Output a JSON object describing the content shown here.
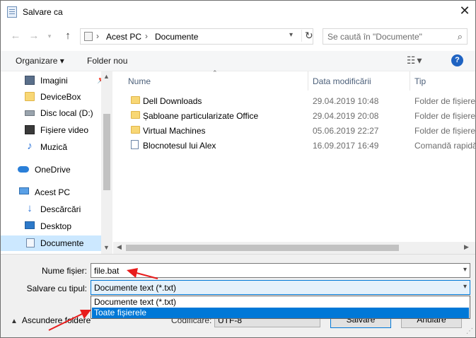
{
  "window": {
    "title": "Salvare ca",
    "close_label": "✕"
  },
  "address": {
    "crumbs": [
      "Acest PC",
      "Documente"
    ],
    "separator": "›"
  },
  "search": {
    "placeholder": "Se caută în \"Documente\""
  },
  "toolbar": {
    "organize_label": "Organizare",
    "organize_caret": "▾",
    "new_folder_label": "Folder nou",
    "help_label": "?"
  },
  "sidebar": {
    "items": [
      {
        "label": "Imagini",
        "icon": "images-icon"
      },
      {
        "label": "DeviceBox",
        "icon": "folder-icon"
      },
      {
        "label": "Disc local (D:)",
        "icon": "drive-icon"
      },
      {
        "label": "Fișiere video",
        "icon": "video-icon"
      },
      {
        "label": "Muzică",
        "icon": "music-icon"
      },
      {
        "label": "OneDrive",
        "icon": "onedrive-icon"
      },
      {
        "label": "Acest PC",
        "icon": "pc-icon"
      },
      {
        "label": "Descărcări",
        "icon": "download-icon"
      },
      {
        "label": "Desktop",
        "icon": "desktop-icon"
      },
      {
        "label": "Documente",
        "icon": "documents-icon",
        "selected": true
      }
    ]
  },
  "filelist": {
    "columns": [
      "Nume",
      "Data modificării",
      "Tip"
    ],
    "rows": [
      {
        "name": "Dell Downloads",
        "date": "29.04.2019 10:48",
        "type": "Folder de fișiere",
        "icon": "folder-icon"
      },
      {
        "name": "Șabloane particularizate Office",
        "date": "29.04.2019 20:08",
        "type": "Folder de fișiere",
        "icon": "folder-icon"
      },
      {
        "name": "Virtual Machines",
        "date": "05.06.2019 22:27",
        "type": "Folder de fișiere",
        "icon": "folder-icon"
      },
      {
        "name": "Blocnotesul lui Alex",
        "date": "16.09.2017 16:49",
        "type": "Comandă rapidă",
        "icon": "shortcut-icon"
      }
    ]
  },
  "form": {
    "filename_label": "Nume fișier:",
    "filename_value": "file.bat",
    "savetype_label": "Salvare cu tipul:",
    "savetype_value": "Documente text (*.txt)",
    "savetype_options": [
      "Documente text (*.txt)",
      "Toate fișierele"
    ],
    "hide_folders_label": "Ascundere foldere",
    "encoding_label": "Codificare:",
    "encoding_value": "UTF-8",
    "save_button": "Salvare",
    "cancel_button": "Anulare"
  },
  "colors": {
    "accent": "#0078d7",
    "selection": "#cce8ff",
    "annotation": "#e81c1c"
  }
}
